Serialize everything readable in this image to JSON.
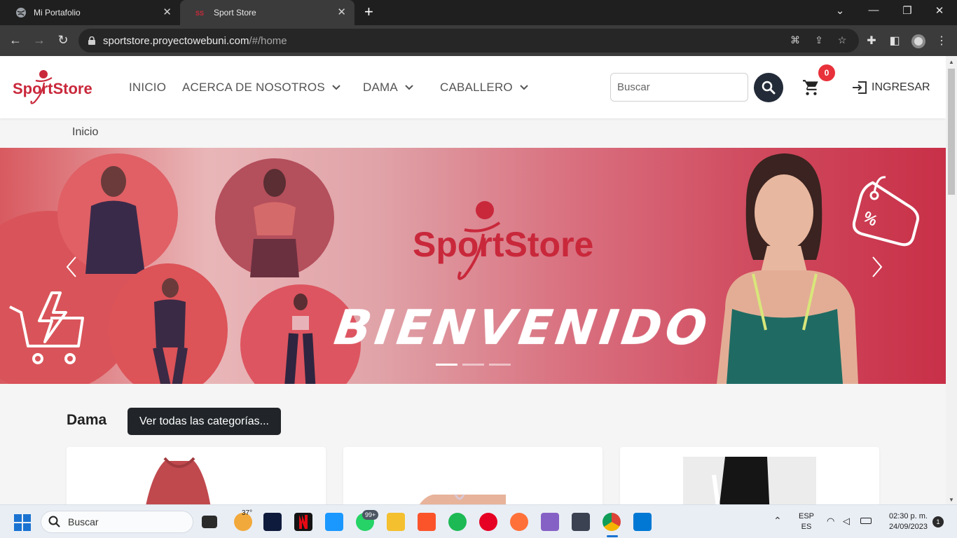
{
  "browser": {
    "tabs": [
      {
        "title": "Mi Portafolio",
        "icon": "globe-icon"
      },
      {
        "title": "Sport Store",
        "icon": "sportstore-favicon"
      }
    ],
    "url_host": "sportstore.proyectowebuni.com",
    "url_path": "/#/home"
  },
  "header": {
    "brand": "SportStore",
    "nav": [
      {
        "label": "INICIO",
        "dropdown": false
      },
      {
        "label": "ACERCA DE NOSOTROS",
        "dropdown": true
      },
      {
        "label": "DAMA",
        "dropdown": true
      },
      {
        "label": "CABALLERO",
        "dropdown": true
      }
    ],
    "search_placeholder": "Buscar",
    "cart_count": "0",
    "login_label": "INGRESAR"
  },
  "breadcrumb": "Inicio",
  "hero": {
    "logo_text": "SportStore",
    "title": "BIENVENIDO",
    "slides": 3,
    "active_slide": 1
  },
  "section": {
    "title": "Dama",
    "all_categories_label": "Ver todas las categorías..."
  },
  "taskbar": {
    "search_placeholder": "Buscar",
    "weather_temp": "37°",
    "whatsapp_badge": "99+",
    "lang_top": "ESP",
    "lang_bottom": "ES",
    "time": "02:30 p. m.",
    "date": "24/09/2023",
    "notifications": "1"
  },
  "colors": {
    "brand_red": "#d1263b",
    "dark_button": "#212529",
    "badge_red": "#e8313a"
  }
}
